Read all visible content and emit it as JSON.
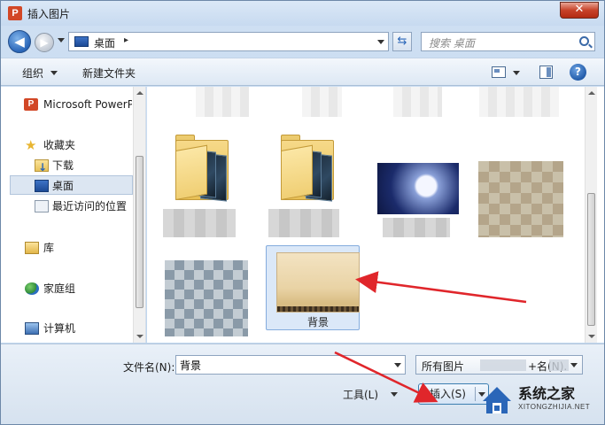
{
  "window": {
    "title": "插入图片",
    "app_icon_letter": "P",
    "close_glyph": "✕"
  },
  "address": {
    "location": "桌面",
    "separator": "▸",
    "search_placeholder": "搜索 桌面"
  },
  "toolbar": {
    "organize": "组织",
    "new_folder": "新建文件夹",
    "help_glyph": "?"
  },
  "nav": {
    "items": [
      {
        "label": "Microsoft PowerPoint",
        "icon": "powerpoint-icon"
      },
      {
        "label": "收藏夹",
        "icon": "star-icon"
      },
      {
        "label": "下载",
        "icon": "download-folder-icon"
      },
      {
        "label": "桌面",
        "icon": "desktop-icon",
        "selected": true
      },
      {
        "label": "最近访问的位置",
        "icon": "recent-places-icon"
      },
      {
        "label": "库",
        "icon": "library-icon"
      },
      {
        "label": "家庭组",
        "icon": "homegroup-icon"
      },
      {
        "label": "计算机",
        "icon": "computer-icon"
      }
    ]
  },
  "files": {
    "items": [
      {
        "type": "folder",
        "label": ""
      },
      {
        "type": "folder",
        "label": ""
      },
      {
        "type": "image",
        "label": "",
        "thumb": "moon-night"
      },
      {
        "type": "image",
        "label": "",
        "thumb": "pixelated"
      },
      {
        "type": "image",
        "label": "",
        "thumb": "pixelated"
      },
      {
        "type": "image",
        "label": "背景",
        "thumb": "parchment",
        "selected": true
      }
    ]
  },
  "bottom": {
    "filename_label": "文件名(N):",
    "filename_value": "背景",
    "filetype_value": "所有图片",
    "filetype_suffix": "+名(N).",
    "tools_label": "工具(L)",
    "insert_label": "插入(S)"
  },
  "watermark": {
    "name": "系统之家",
    "url": "XITONGZHIJIA.NET"
  },
  "colors": {
    "accent": "#2a66b8",
    "selection": "#dbe8f8",
    "annotation_arrow": "#e0262b",
    "folder": "#f0cf74"
  }
}
